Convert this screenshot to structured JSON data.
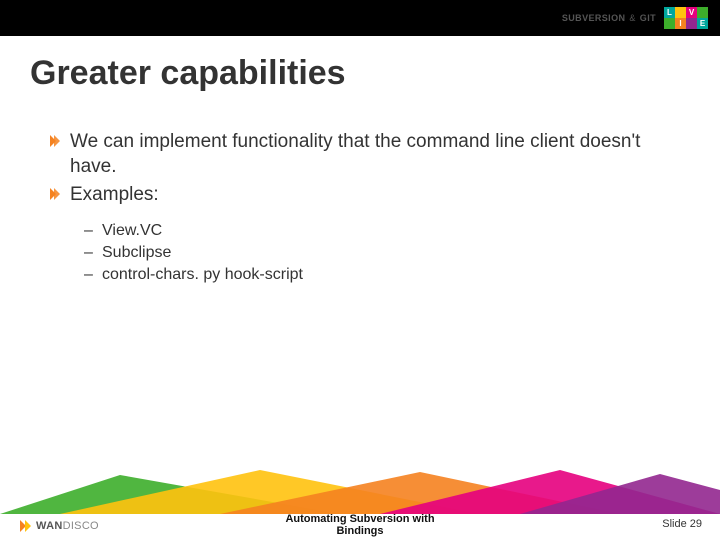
{
  "header": {
    "brand_left": "SUBVERSION",
    "brand_amp": "&",
    "brand_right": "GIT",
    "live": [
      "L",
      "I",
      "V",
      "E"
    ]
  },
  "title": "Greater capabilities",
  "bullets": [
    "We can implement functionality that the command line client doesn't have.",
    "Examples:"
  ],
  "sub_bullets": [
    "View.VC",
    "Subclipse",
    "control-chars. py hook-script"
  ],
  "footer": {
    "logo_a": "WAN",
    "logo_b": "DISCO",
    "center_line1": "Automating Subversion with",
    "center_line2": "Bindings",
    "slide_label": "Slide 29"
  },
  "colors": {
    "orange": "#f58220",
    "magenta": "#e6007e",
    "green": "#3dae2b",
    "teal": "#00a79d",
    "yellow": "#ffc20e",
    "purple": "#92278f"
  }
}
